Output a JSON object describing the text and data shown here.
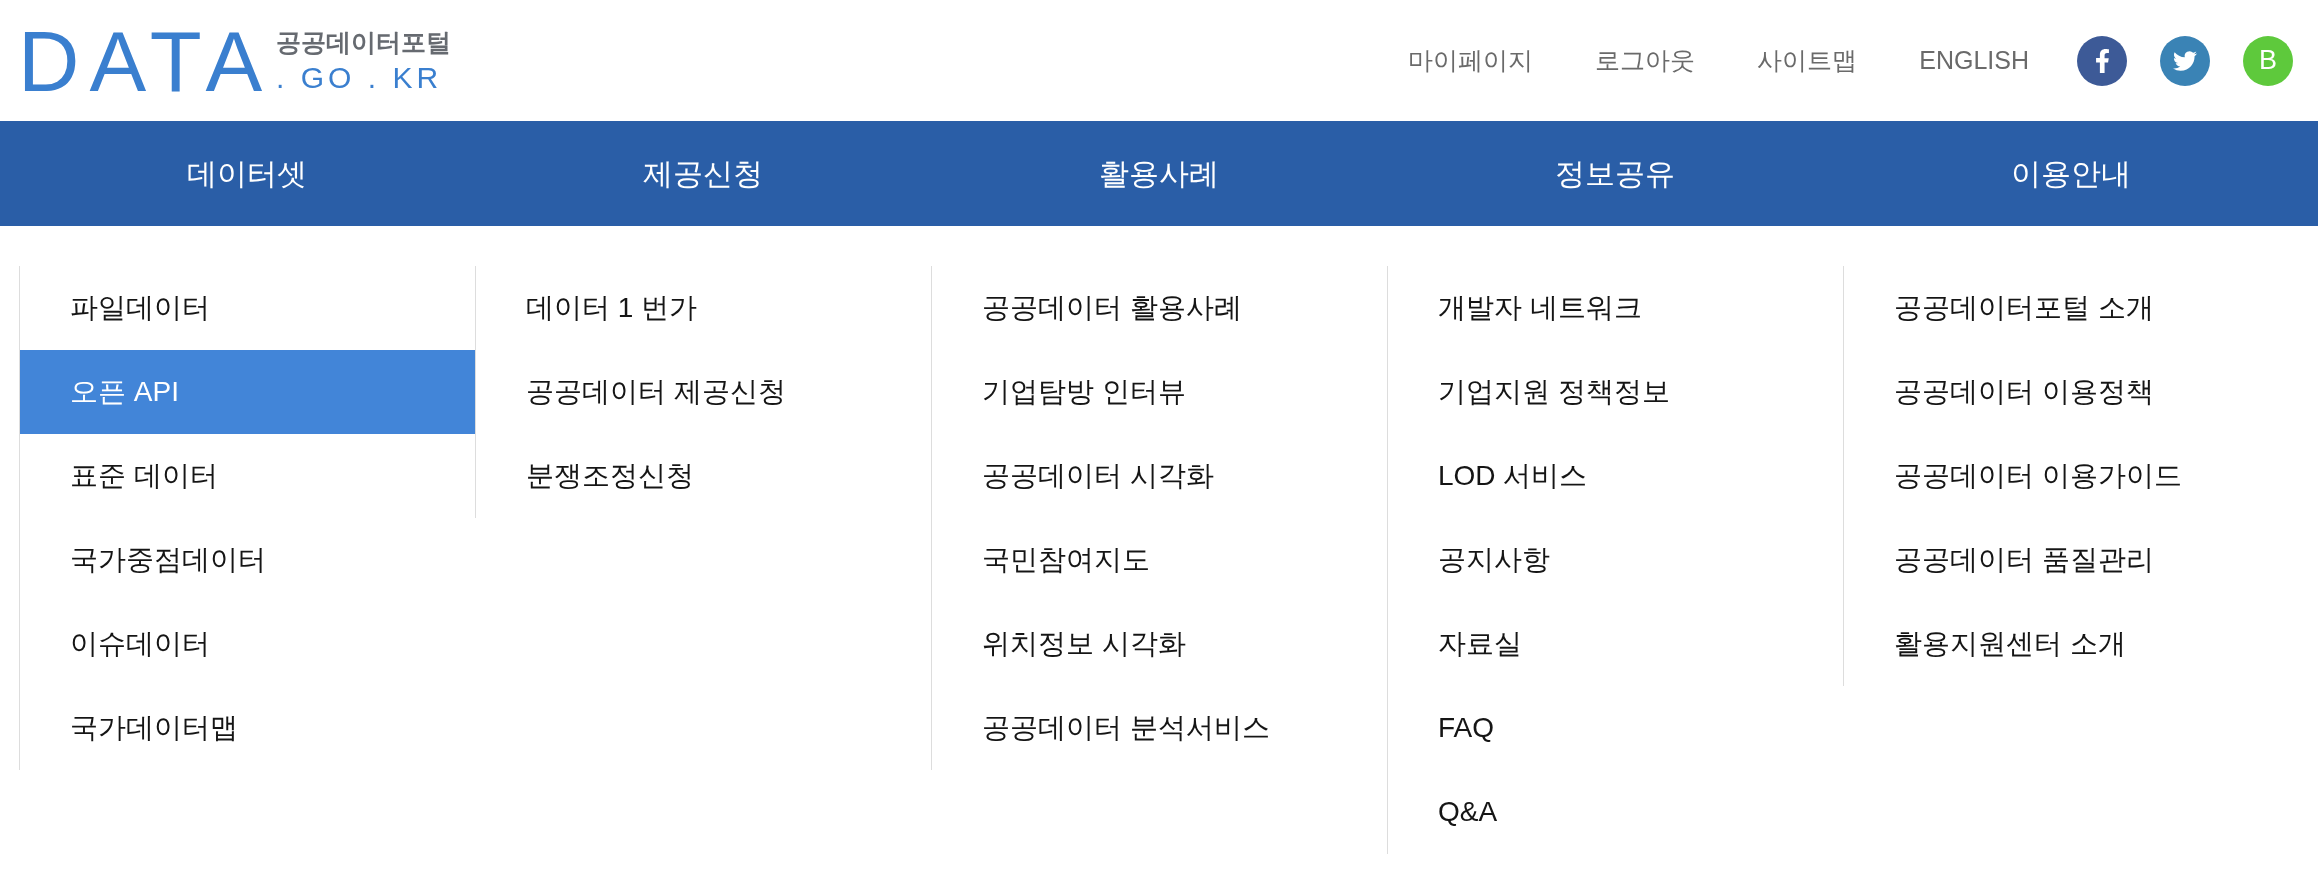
{
  "header": {
    "logo": {
      "wordmark": "DATA",
      "title": "공공데이터포털",
      "domain": ". GO . KR"
    },
    "links": [
      "마이페이지",
      "로그아웃",
      "사이트맵",
      "ENGLISH"
    ],
    "social": [
      {
        "kind": "facebook"
      },
      {
        "kind": "twitter"
      },
      {
        "kind": "letter",
        "label": "B"
      }
    ]
  },
  "nav": {
    "items": [
      "데이터셋",
      "제공신청",
      "활용사례",
      "정보공유",
      "이용안내"
    ]
  },
  "menu": {
    "columns": [
      {
        "items": [
          {
            "label": "파일데이터",
            "selected": false
          },
          {
            "label": "오픈 API",
            "selected": true
          },
          {
            "label": "표준 데이터",
            "selected": false
          },
          {
            "label": "국가중점데이터",
            "selected": false
          },
          {
            "label": "이슈데이터",
            "selected": false
          },
          {
            "label": "국가데이터맵",
            "selected": false
          }
        ]
      },
      {
        "items": [
          {
            "label": "데이터 1 번가",
            "selected": false
          },
          {
            "label": "공공데이터 제공신청",
            "selected": false
          },
          {
            "label": "분쟁조정신청",
            "selected": false
          }
        ]
      },
      {
        "items": [
          {
            "label": "공공데이터 활용사례",
            "selected": false
          },
          {
            "label": "기업탐방 인터뷰",
            "selected": false
          },
          {
            "label": "공공데이터 시각화",
            "selected": false
          },
          {
            "label": "국민참여지도",
            "selected": false
          },
          {
            "label": "위치정보 시각화",
            "selected": false
          },
          {
            "label": "공공데이터 분석서비스",
            "selected": false
          }
        ]
      },
      {
        "items": [
          {
            "label": "개발자 네트워크",
            "selected": false
          },
          {
            "label": "기업지원 정책정보",
            "selected": false
          },
          {
            "label": "LOD 서비스",
            "selected": false
          },
          {
            "label": "공지사항",
            "selected": false
          },
          {
            "label": "자료실",
            "selected": false
          },
          {
            "label": "FAQ",
            "selected": false
          },
          {
            "label": "Q&A",
            "selected": false
          }
        ]
      },
      {
        "items": [
          {
            "label": "공공데이터포털 소개",
            "selected": false
          },
          {
            "label": "공공데이터 이용정책",
            "selected": false
          },
          {
            "label": "공공데이터 이용가이드",
            "selected": false
          },
          {
            "label": "공공데이터 품질관리",
            "selected": false
          },
          {
            "label": "활용지원센터 소개",
            "selected": false
          }
        ]
      }
    ]
  }
}
